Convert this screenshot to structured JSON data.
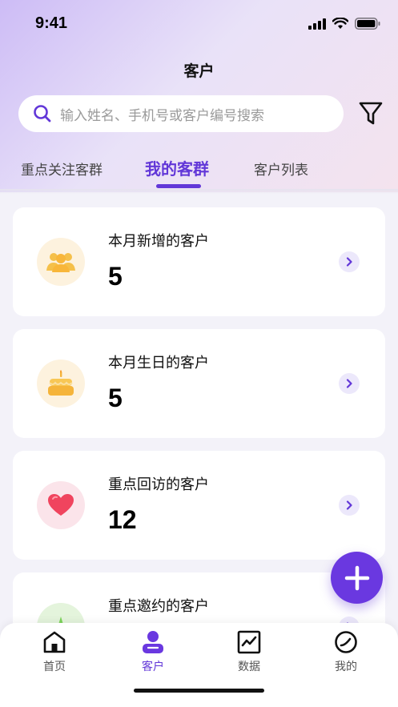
{
  "status_bar": {
    "time": "9:41"
  },
  "header": {
    "title": "客户"
  },
  "search": {
    "placeholder": "输入姓名、手机号或客户编号搜索"
  },
  "tabs": [
    {
      "label": "重点关注客群",
      "active": false
    },
    {
      "label": "我的客群",
      "active": true
    },
    {
      "label": "客户列表",
      "active": false
    }
  ],
  "cards": [
    {
      "title": "本月新增的客户",
      "count": "5",
      "icon": "people-icon"
    },
    {
      "title": "本月生日的客户",
      "count": "5",
      "icon": "cake-icon"
    },
    {
      "title": "重点回访的客户",
      "count": "12",
      "icon": "heart-icon"
    },
    {
      "title": "重点邀约的客户",
      "count": "",
      "icon": "star-icon"
    }
  ],
  "bottom_nav": [
    {
      "label": "首页",
      "icon": "home-icon",
      "active": false
    },
    {
      "label": "客户",
      "icon": "customer-icon",
      "active": true
    },
    {
      "label": "数据",
      "icon": "chart-icon",
      "active": false
    },
    {
      "label": "我的",
      "icon": "profile-icon",
      "active": false
    }
  ],
  "colors": {
    "accent": "#6237d8",
    "fab": "#6a38e0",
    "background": "#f3f2f9"
  }
}
